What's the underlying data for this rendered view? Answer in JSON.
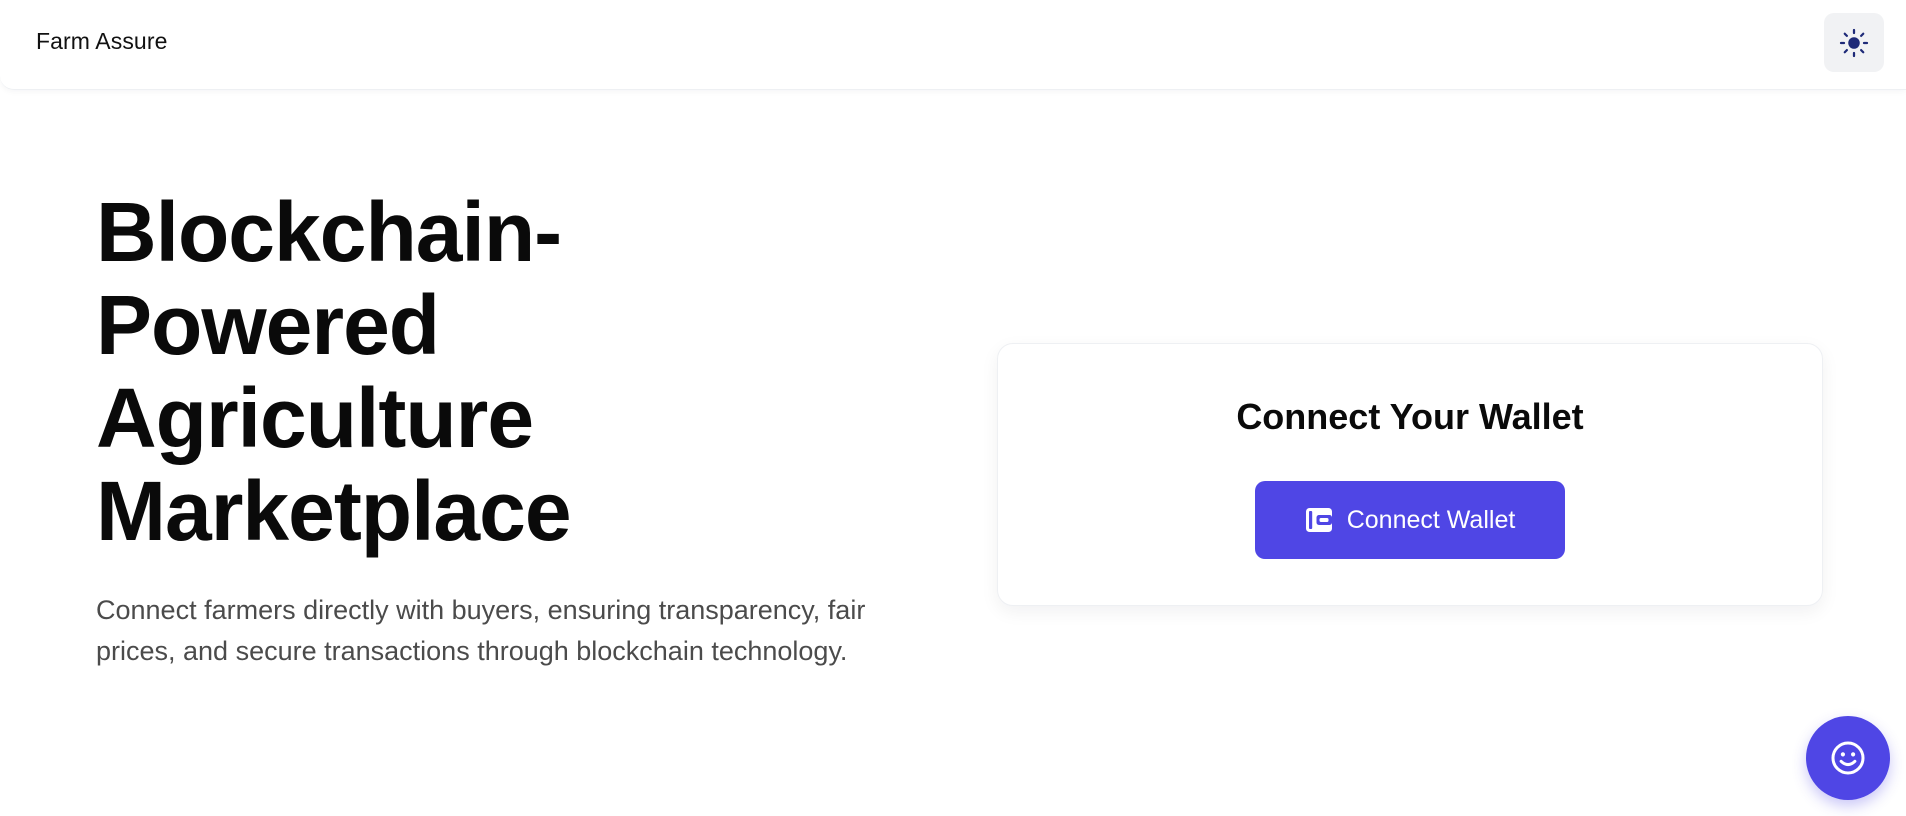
{
  "header": {
    "brand": "Farm Assure",
    "theme_toggle_icon": "sun-icon"
  },
  "hero": {
    "title_lines": [
      "Blockchain-",
      "Powered",
      "Agriculture",
      "Marketplace"
    ],
    "subtitle": "Connect farmers directly with buyers, ensuring transparency, fair prices, and secure transactions through blockchain technology."
  },
  "wallet_card": {
    "title": "Connect Your Wallet",
    "button_label": "Connect Wallet",
    "button_icon": "wallet-icon"
  },
  "fab": {
    "icon": "smile-icon"
  },
  "colors": {
    "accent": "#4f46e5",
    "sun_icon": "#1e2a78",
    "text_primary": "#0a0a0a",
    "text_secondary": "#4b4b4b",
    "toggle_bg": "#f1f2f4"
  }
}
